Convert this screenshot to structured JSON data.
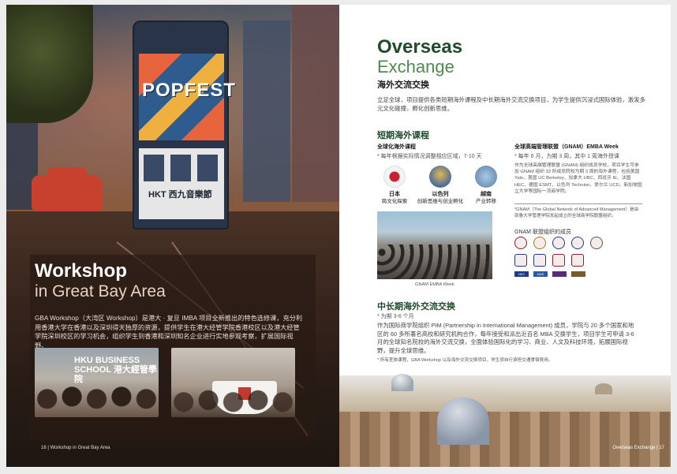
{
  "left_page": {
    "tram_text": "POPFEST",
    "tram_brand": "HKT 西九音樂節",
    "workshop_title": "Workshop",
    "workshop_subtitle": "in Great Bay Area",
    "workshop_body": "GBA Workshop（大湾区 Workshop）是港大 · 复旦 IMBA 项目全新推出的特色选修课，充分利用香港大学在香港以及深圳得天独厚的资源，提供学生在港大经管学院香港校区以及港大经管学院深圳校区的学习机会，组织学生到香港和深圳知名企业进行实地参观考察，扩展国际视野。",
    "photo1_sign": "HKU BUSINESS SCHOOL 港大經管學院",
    "footer": "16 | Workshop in Great Bay Area"
  },
  "right_page": {
    "title": "Overseas",
    "subtitle": "Exchange",
    "title_cn": "海外交流交换",
    "intro": "立足全球，项目提供各类短期海外课程及中长期海外交流交换项目，为学生提供沉浸式国际体验，激发多元文化碰撞，孵化创新思维。",
    "short_title": "短期海外课程",
    "global_title": "全球化海外课程",
    "global_note": "* 每年根据实际情况调整相应区域，7-10 天",
    "destinations": [
      {
        "country": "日本",
        "theme": "跨文化探索",
        "color": "#f3f3f3"
      },
      {
        "country": "以色列",
        "theme": "创新思维与创业孵化",
        "color": "#d8b45a"
      },
      {
        "country": "越南",
        "theme": "产业转移",
        "color": "#b8c6d8"
      }
    ],
    "gnam_title": "全球高端管理联盟（GNAM）EMBA Week",
    "gnam_note": "* 每年 6 月，为期 3 周，其中 1 周海外授课",
    "gnam_body": "作为全球高端管理联盟 (GNAM) 组织成员学校，项目学生可参加 GNAM 组织 32 所成员院校为期 3 周的海外课程，包括美国 Yale、美国 UC Berkeley、加拿大 UBC、西班牙 IE、法国 HEC、德国 ESMT、以色列 Technion、爱尔兰 UCD、新加坡国立大学等国际一流商学院。",
    "gnam_footnote": "*GNAM（The Global Network of Advanced Management）是由耶鲁大学管理学院发起成立的全球商学院联盟组织。",
    "photo_caption": "GNAM EMBA Week",
    "members_title": "GNAM 联盟组织的成员",
    "member_labels": [
      "ESSEC",
      "HEC",
      "NUS"
    ],
    "mid_title": "中长期海外交流交换",
    "mid_duration": "* 为期 3-6 个月",
    "mid_body": "作为国际商学院组织 PIM (Partnership in International Management) 成员，学院与 20 多个国家和地区的 60 多所著名高校和研究机构合作，每年接受和派出近百名 MBA 交换学生，项目学生可申请 3-6 月的全球知名院校的海外交流交换，全面体验国际化的学习、商业、人文及科技环境，拓展国际视野，提升全球思维。",
    "mid_note": "* 所有差旅课程，GBA Workshop 以及海外交流交换项目，学生须自行承担交通食宿费用。",
    "footer": "Overseas Exchange | 17"
  },
  "colors": {
    "green_dark": "#1f4a2c",
    "green_light": "#4d8a50"
  }
}
